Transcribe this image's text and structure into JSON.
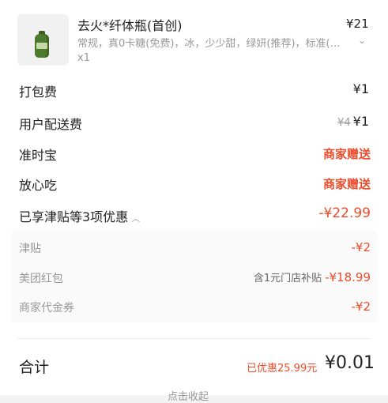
{
  "item": {
    "name": "去火*纤体瓶(首创)",
    "price": "¥21",
    "options": "常规，真0卡糖(免费)，冰，少少甜，绿妍(推荐)，标准(…",
    "quantity": "x1",
    "image_icon": "green-bottle-icon"
  },
  "fees": {
    "packing_label": "打包费",
    "packing_value": "¥1",
    "delivery_label": "用户配送费",
    "delivery_original": "¥4",
    "delivery_value": "¥1",
    "ontime_label": "准时宝",
    "ontime_value": "商家赠送",
    "safe_label": "放心吃",
    "safe_value": "商家赠送"
  },
  "discounts": {
    "summary_label": "已享津贴等3项优惠",
    "summary_value": "-¥22.99",
    "items": [
      {
        "label": "津贴",
        "note": "",
        "value": "-¥2"
      },
      {
        "label": "美团红包",
        "note": "含1元门店补贴",
        "value": "-¥18.99"
      },
      {
        "label": "商家代金券",
        "note": "",
        "value": "-¥2"
      }
    ]
  },
  "total": {
    "label": "合计",
    "saved": "已优惠25.99元",
    "amount": "¥0.01"
  },
  "footer": {
    "collapse_label": "点击收起"
  },
  "colors": {
    "accent_red": "#ee4b2b",
    "muted": "#999999"
  }
}
